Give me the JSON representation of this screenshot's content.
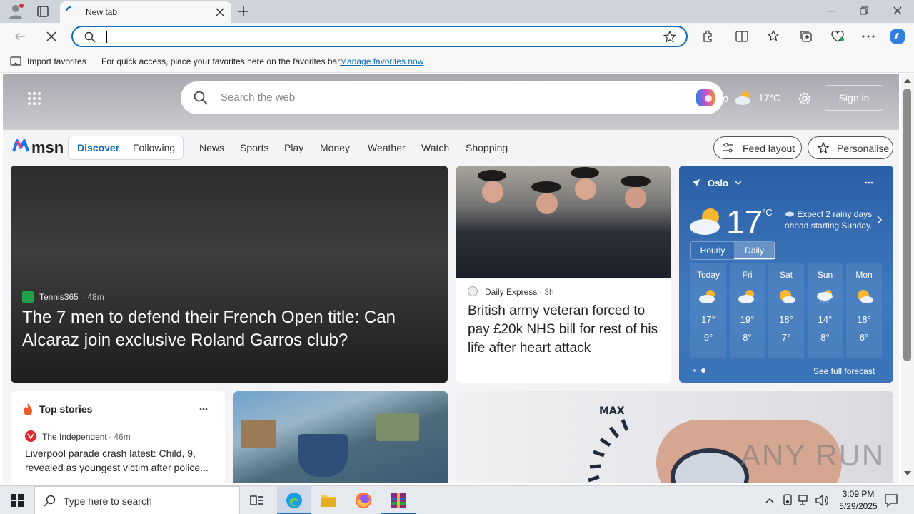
{
  "browser": {
    "tab_title": "New tab",
    "address_value": "",
    "favbar": {
      "import_label": "Import favorites",
      "message": "For quick access, place your favorites here on the favorites bar.",
      "manage_link": "Manage favorites now"
    }
  },
  "msn": {
    "search_placeholder": "Search the web",
    "temp_top": "17°C",
    "sign_in": "Sign in",
    "logo_text": "msn",
    "tabs": [
      "Discover",
      "Following"
    ],
    "nav": [
      "News",
      "Sports",
      "Play",
      "Money",
      "Weather",
      "Watch",
      "Shopping"
    ],
    "feed_layout": "Feed layout",
    "personalise": "Personalise",
    "hero": {
      "source": "Tennis365",
      "age": "48m",
      "title": "The 7 men to defend their French Open title: Can Alcaraz join exclusive Roland Garros club?"
    },
    "card2": {
      "source": "Daily Express",
      "age": "3h",
      "title": "British army veteran forced to pay £20k NHS bill for rest of his life after heart attack"
    },
    "weather": {
      "city": "Oslo",
      "temp": "17",
      "unit": "°C",
      "note": "Expect 2 rainy days ahead starting Sunday.",
      "mode_tabs": [
        "Hourly",
        "Daily"
      ],
      "days": [
        {
          "day": "Today",
          "hi": "17°",
          "lo": "9°",
          "icon": "partly-cloudy-icon"
        },
        {
          "day": "Fri",
          "hi": "19°",
          "lo": "8°",
          "icon": "partly-cloudy-icon"
        },
        {
          "day": "Sat",
          "hi": "18°",
          "lo": "7°",
          "icon": "partly-sunny-icon"
        },
        {
          "day": "Sun",
          "hi": "14°",
          "lo": "8°",
          "icon": "rain-icon"
        },
        {
          "day": "Mon",
          "hi": "18°",
          "lo": "6°",
          "icon": "partly-sunny-icon"
        }
      ],
      "see_full": "See full forecast"
    },
    "top_stories": {
      "heading": "Top stories",
      "source": "The Independent",
      "age": "46m",
      "headline": "Liverpool parade crash latest: Child, 9, revealed as youngest victim after police..."
    },
    "watermark": "ANY RUN"
  },
  "taskbar": {
    "search_placeholder": "Type here to search",
    "time": "3:09 PM",
    "date": "5/29/2025"
  },
  "colors": {
    "accent": "#0f6cbd",
    "weather_bg": "#2b5fa6",
    "taskbar": "#e6e9ee"
  }
}
